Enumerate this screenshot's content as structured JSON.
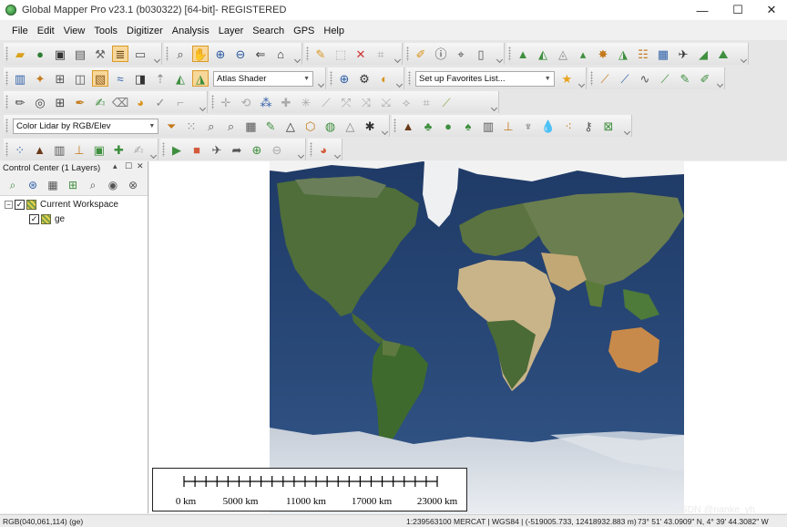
{
  "window": {
    "title": "Global Mapper Pro v23.1 (b030322) [64-bit]- REGISTERED",
    "controls": {
      "minimize": "—",
      "maximize": "☐",
      "close": "✕"
    }
  },
  "menu": [
    "File",
    "Edit",
    "View",
    "Tools",
    "Digitizer",
    "Analysis",
    "Layer",
    "Search",
    "GPS",
    "Help"
  ],
  "toolbars": {
    "shader_select": "Atlas Shader",
    "favorites_select": "Set up Favorites List...",
    "lidar_select": "Color Lidar by RGB/Elev"
  },
  "control_center": {
    "title": "Control Center (1 Layers)",
    "header_controls": {
      "pin": "▴",
      "restore": "☐",
      "close": "✕"
    },
    "workspace_label": "Current Workspace",
    "layers": [
      {
        "name": "ge"
      }
    ]
  },
  "scale_bar": {
    "labels": [
      "0 km",
      "5000 km",
      "11000 km",
      "17000 km",
      "23000 km"
    ]
  },
  "status_bar": {
    "pixel_value": "RGB(040,061,114) (ge)",
    "scale": "1:239563100",
    "projection": "MERCAT | WGS84 | (-519005.733, 12418932.883 m)",
    "coordinates": "73° 51' 43.0909\" N, 4° 39' 44.3082\" W"
  },
  "watermark": "CSDN @nanke_yh",
  "colors": {
    "ocean": "#2a4a7a",
    "land_green": "#4f6e3a",
    "desert": "#c9b48a",
    "ice": "#e4e8ee",
    "active_tool": "#f8d79a"
  }
}
